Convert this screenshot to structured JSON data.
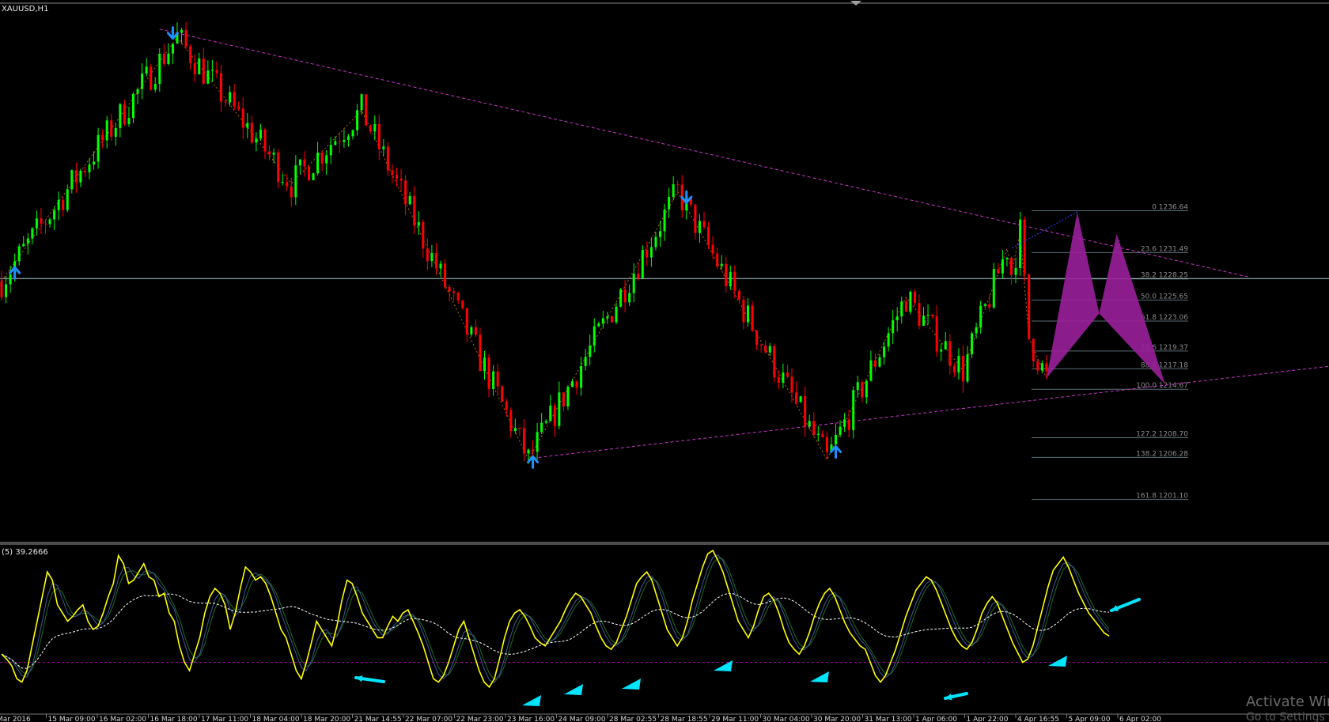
{
  "window": {
    "symbol_label": "XAUUSD,H1",
    "indicator_label": "(5) 39.2666",
    "watermark_line1": "Activate Win",
    "watermark_line2": "Go to Settings t"
  },
  "colors": {
    "background": "#000000",
    "bull": "#00ff00",
    "bear": "#ff0000",
    "trendline": "#cc33cc",
    "zigzag": "#b86a00",
    "harmonic_fill": "#9a1f9a",
    "arrow": "#1e90ff",
    "hline": "#a8c8d0",
    "fib": "#5a6e74",
    "fib_text": "#8a8a8a",
    "osc_main": "#ffff00",
    "osc_signal_a": "#3c5a9a",
    "osc_signal_b": "#1e6e1e",
    "osc_avg": "#ffffff",
    "osc_level": "#b400b4",
    "cyan_marker": "#00e5ff"
  },
  "chart_data": [
    {
      "type": "candlestick",
      "symbol": "XAUUSD",
      "timeframe": "H1",
      "ylim": [
        1196,
        1262
      ],
      "current_price": 1228.3,
      "x_ticks": [
        "Mar 2016",
        "15 Mar 09:00",
        "16 Mar 02:00",
        "16 Mar 18:00",
        "17 Mar 11:00",
        "18 Mar 04:00",
        "18 Mar 20:00",
        "21 Mar 14:55",
        "22 Mar 07:00",
        "22 Mar 23:00",
        "23 Mar 16:00",
        "24 Mar 09:00",
        "28 Mar 02:55",
        "28 Mar 18:55",
        "29 Mar 11:00",
        "30 Mar 04:00",
        "30 Mar 20:00",
        "31 Mar 13:00",
        "1 Apr 06:00",
        "1 Apr 22:00",
        "4 Apr 16:55",
        "5 Apr 09:00",
        "6 Apr 02:00"
      ],
      "fibonacci": [
        {
          "level": "0",
          "price": 1236.64
        },
        {
          "level": "23.6",
          "price": 1231.49
        },
        {
          "level": "38.2",
          "price": 1228.25
        },
        {
          "level": "50.0",
          "price": 1225.65
        },
        {
          "level": "61.8",
          "price": 1223.06
        },
        {
          "level": "78.6",
          "price": 1219.37
        },
        {
          "level": "88.6",
          "price": 1217.18
        },
        {
          "level": "100.0",
          "price": 1214.67
        },
        {
          "level": "127.2",
          "price": 1208.7
        },
        {
          "level": "138.2",
          "price": 1206.28
        },
        {
          "level": "161.8",
          "price": 1201.1
        }
      ],
      "zigzag": [
        {
          "bar": 0,
          "price": 1228
        },
        {
          "bar": 40,
          "price": 1258
        },
        {
          "bar": 66,
          "price": 1240
        },
        {
          "bar": 82,
          "price": 1249
        },
        {
          "bar": 120,
          "price": 1206
        },
        {
          "bar": 154,
          "price": 1239
        },
        {
          "bar": 188,
          "price": 1206
        },
        {
          "bar": 206,
          "price": 1226
        },
        {
          "bar": 219,
          "price": 1217
        },
        {
          "bar": 229,
          "price": 1232
        },
        {
          "bar": 230,
          "price": 1229
        },
        {
          "bar": 232,
          "price": 1234
        },
        {
          "bar": 234,
          "price": 1221
        },
        {
          "bar": 238,
          "price": 1216
        }
      ],
      "fractal_arrows": [
        {
          "bar": 3,
          "dir": "up"
        },
        {
          "bar": 39,
          "dir": "down"
        },
        {
          "bar": 121,
          "dir": "up"
        },
        {
          "bar": 156,
          "dir": "down"
        },
        {
          "bar": 190,
          "dir": "up"
        }
      ]
    },
    {
      "type": "line",
      "name": "oscillator",
      "ylim": [
        0,
        100
      ],
      "level": 30,
      "series": [
        {
          "name": "main",
          "values": [
            35,
            32,
            28,
            20,
            18,
            25,
            40,
            55,
            70,
            85,
            80,
            65,
            60,
            55,
            58,
            62,
            65,
            55,
            50,
            52,
            60,
            70,
            78,
            95,
            90,
            78,
            80,
            85,
            90,
            82,
            80,
            70,
            72,
            60,
            55,
            40,
            30,
            25,
            35,
            45,
            60,
            70,
            75,
            72,
            65,
            50,
            60,
            75,
            88,
            85,
            80,
            82,
            78,
            70,
            60,
            50,
            45,
            35,
            25,
            20,
            30,
            42,
            55,
            50,
            45,
            40,
            52,
            68,
            80,
            78,
            70,
            60,
            55,
            50,
            45,
            45,
            52,
            58,
            55,
            60,
            62,
            55,
            48,
            40,
            30,
            20,
            18,
            22,
            30,
            40,
            50,
            55,
            45,
            35,
            25,
            18,
            15,
            20,
            32,
            45,
            55,
            60,
            62,
            58,
            52,
            45,
            42,
            40,
            45,
            50,
            55,
            62,
            68,
            72,
            70,
            65,
            60,
            52,
            45,
            40,
            38,
            42,
            50,
            58,
            68,
            78,
            82,
            85,
            80,
            70,
            60,
            50,
            45,
            40,
            45,
            55,
            68,
            78,
            88,
            96,
            98,
            92,
            85,
            75,
            65,
            55,
            50,
            45,
            52,
            62,
            70,
            72,
            68,
            60,
            50,
            42,
            38,
            35,
            40,
            48,
            58,
            66,
            72,
            75,
            70,
            62,
            54,
            48,
            44,
            40,
            38,
            30,
            22,
            18,
            22,
            30,
            38,
            48,
            58,
            66,
            74,
            78,
            82,
            80,
            74,
            66,
            58,
            50,
            44,
            40,
            38,
            42,
            50,
            60,
            66,
            70,
            66,
            58,
            50,
            42,
            36,
            30,
            32,
            40,
            52,
            64,
            76,
            86,
            90,
            94,
            88,
            80,
            72,
            66,
            60,
            56,
            52,
            48,
            46
          ]
        }
      ]
    }
  ]
}
